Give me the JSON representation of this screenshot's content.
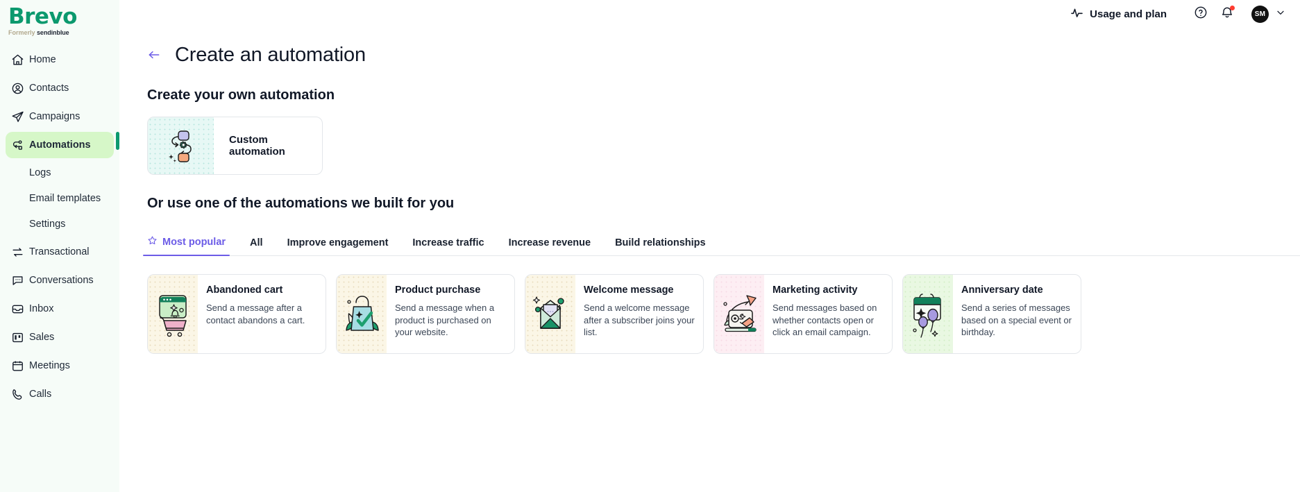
{
  "brand": {
    "name": "Brevo",
    "formerly": "Formerly",
    "former_name": "sendinblue",
    "accent_green": "#0b996e",
    "accent_purple": "#6c5ce7"
  },
  "sidebar": {
    "items": [
      {
        "label": "Home",
        "icon": "home-icon",
        "active": false,
        "sub": false
      },
      {
        "label": "Contacts",
        "icon": "contacts-icon",
        "active": false,
        "sub": false
      },
      {
        "label": "Campaigns",
        "icon": "campaigns-icon",
        "active": false,
        "sub": false
      },
      {
        "label": "Automations",
        "icon": "automations-icon",
        "active": true,
        "sub": false
      },
      {
        "label": "Logs",
        "icon": "",
        "active": false,
        "sub": true
      },
      {
        "label": "Email templates",
        "icon": "",
        "active": false,
        "sub": true
      },
      {
        "label": "Settings",
        "icon": "",
        "active": false,
        "sub": true
      },
      {
        "label": "Transactional",
        "icon": "transactional-icon",
        "active": false,
        "sub": false
      },
      {
        "label": "Conversations",
        "icon": "conversations-icon",
        "active": false,
        "sub": false
      },
      {
        "label": "Inbox",
        "icon": "inbox-icon",
        "active": false,
        "sub": false
      },
      {
        "label": "Sales",
        "icon": "sales-icon",
        "active": false,
        "sub": false
      },
      {
        "label": "Meetings",
        "icon": "meetings-icon",
        "active": false,
        "sub": false
      },
      {
        "label": "Calls",
        "icon": "calls-icon",
        "active": false,
        "sub": false
      }
    ]
  },
  "topbar": {
    "usage_label": "Usage and plan",
    "usage_icon": "activity-pulse-icon",
    "help_icon": "help-circle-icon",
    "notifications_icon": "bell-icon",
    "has_notification": true,
    "avatar_initials": "SM",
    "chevron_icon": "chevron-down-icon"
  },
  "page": {
    "back_icon": "arrow-left-icon",
    "title": "Create an automation",
    "section_own": "Create your own automation",
    "section_builtin": "Or use one of the automations we built for you"
  },
  "custom_automation": {
    "title": "Custom automation",
    "icon": "workflow-nodes-icon"
  },
  "tabs": [
    {
      "label": "Most popular",
      "icon": "star-icon",
      "active": true
    },
    {
      "label": "All",
      "icon": "",
      "active": false
    },
    {
      "label": "Improve engagement",
      "icon": "",
      "active": false
    },
    {
      "label": "Increase traffic",
      "icon": "",
      "active": false
    },
    {
      "label": "Increase revenue",
      "icon": "",
      "active": false
    },
    {
      "label": "Build relationships",
      "icon": "",
      "active": false
    }
  ],
  "templates": [
    {
      "title": "Abandoned cart",
      "description": "Send a message after a contact abandons a cart.",
      "icon": "abandoned-cart-icon",
      "thumb_bg": "#fbf6e6",
      "thumb_dot": "#ede3c6"
    },
    {
      "title": "Product purchase",
      "description": "Send a message when a product is purchased on your website.",
      "icon": "product-purchase-icon",
      "thumb_bg": "#fbf6e6",
      "thumb_dot": "#ede3c6"
    },
    {
      "title": "Welcome message",
      "description": "Send a welcome message after a subscriber joins your list.",
      "icon": "welcome-message-icon",
      "thumb_bg": "#fbf6e6",
      "thumb_dot": "#ede3c6"
    },
    {
      "title": "Marketing activity",
      "description": "Send messages based on whether contacts open or click an email campaign.",
      "icon": "marketing-activity-icon",
      "thumb_bg": "#fdeef3",
      "thumb_dot": "#f6d9e3"
    },
    {
      "title": "Anniversary date",
      "description": "Send a series of messages based on a special event or birthday.",
      "icon": "anniversary-date-icon",
      "thumb_bg": "#e9f8e2",
      "thumb_dot": "#d0edc4"
    }
  ]
}
